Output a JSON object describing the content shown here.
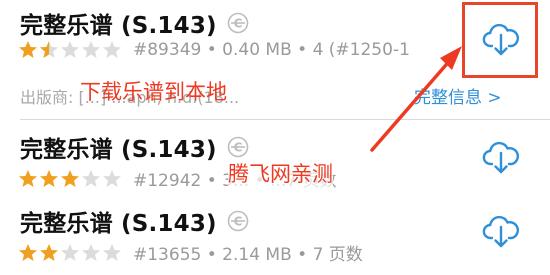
{
  "items": [
    {
      "title": "完整乐谱 (S.143)",
      "rating": 1.5,
      "meta": "#89349 • 0.40 MB • 4 (#1250-1",
      "publisher": "出版商: [...] ...aph, n.d.(18...",
      "details_link": "完整信息 >"
    },
    {
      "title": "完整乐谱 (S.143)",
      "rating": 3,
      "meta": "#12942 • 3... • ...7 页数"
    },
    {
      "title": "完整乐谱 (S.143)",
      "rating": 2,
      "meta": "#13655 • 2.14 MB • 7 页数"
    }
  ],
  "annotations": {
    "download_label": "下载乐谱到本地",
    "tested_label": "腾飞网亲测"
  },
  "colors": {
    "star_filled": "#f0a020",
    "star_empty": "#dcdcdc",
    "accent_blue": "#2f8fd8",
    "annotation_red": "#ee3a22"
  }
}
